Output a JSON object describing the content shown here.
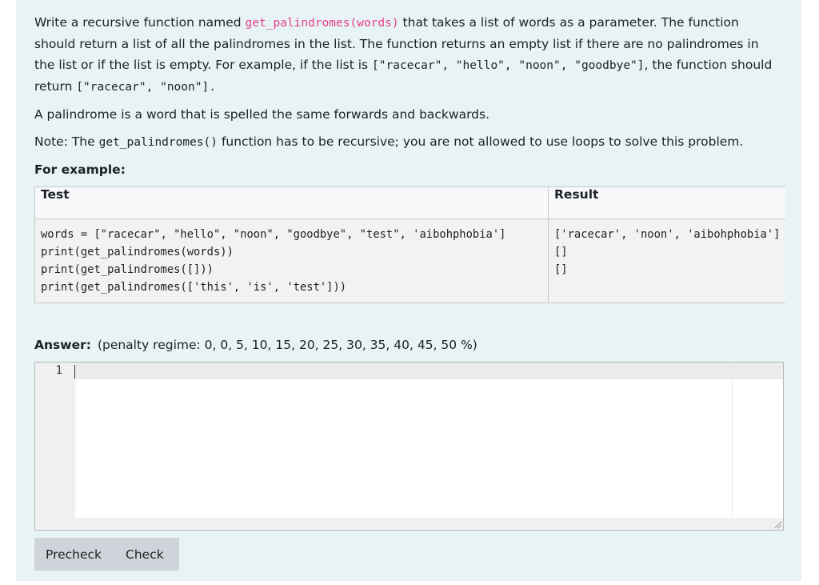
{
  "question": {
    "intro_1": "Write a recursive function named ",
    "fn_signature": "get_palindromes(words)",
    "intro_2": " that takes a list of words as a parameter. The function should return a list of all the palindromes in the list. The function returns an empty list if there are no palindromes in the list or if the list is empty. For example, if the list is ",
    "example_list": "[\"racecar\", \"hello\", \"noon\", \"goodbye\"]",
    "intro_3": ", the function should return ",
    "example_result": "[\"racecar\", \"noon\"].",
    "definition": "A palindrome is a word that is spelled the same forwards and backwards.",
    "note_1": "Note: The ",
    "note_fn": "get_palindromes()",
    "note_2": " function has to be recursive; you are not allowed to use loops to solve this problem.",
    "for_example": "For example:"
  },
  "examples_table": {
    "headers": [
      "Test",
      "Result"
    ],
    "test_lines": [
      "words = [\"racecar\", \"hello\", \"noon\", \"goodbye\", \"test\", 'aibohphobia']",
      "print(get_palindromes(words))",
      "print(get_palindromes([]))",
      "print(get_palindromes(['this', 'is', 'test']))"
    ],
    "result_lines": [
      "['racecar', 'noon', 'aibohphobia']",
      "[]",
      "[]"
    ]
  },
  "answer": {
    "label": "Answer:",
    "penalty": "(penalty regime: 0, 0, 5, 10, 15, 20, 25, 30, 35, 40, 45, 50 %)",
    "line_number": "1",
    "code": ""
  },
  "buttons": {
    "precheck": "Precheck",
    "check": "Check"
  }
}
